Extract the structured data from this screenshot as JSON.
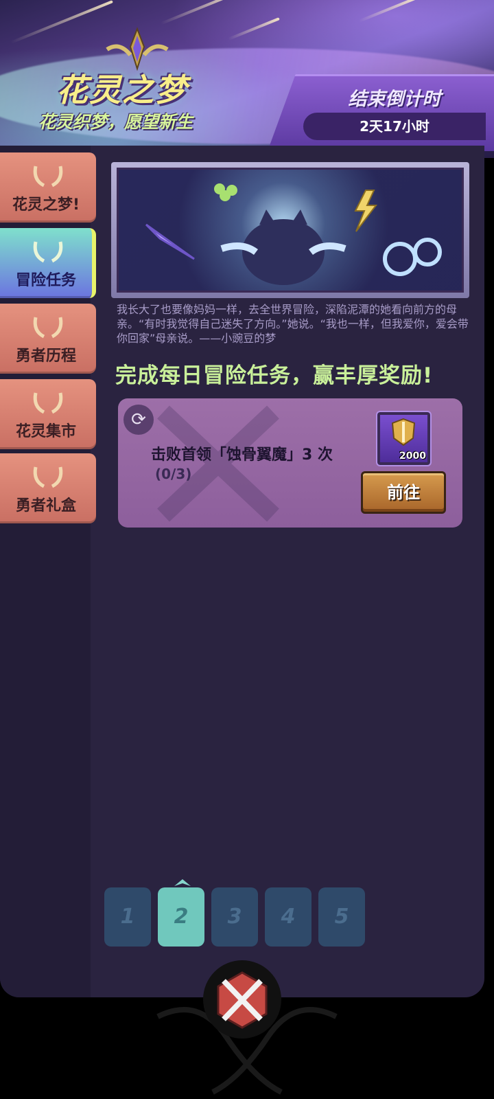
{
  "header": {
    "title": "花灵之梦",
    "subtitle": "花灵织梦，愿望新生",
    "countdown_label": "结束倒计时",
    "countdown_value": "2天17小时"
  },
  "sidebar": {
    "items": [
      {
        "label": "花灵之梦!",
        "active": false
      },
      {
        "label": "冒险任务",
        "active": true
      },
      {
        "label": "勇者历程",
        "active": false
      },
      {
        "label": "花灵集市",
        "active": false
      },
      {
        "label": "勇者礼盒",
        "active": false
      }
    ]
  },
  "main": {
    "story": "我长大了也要像妈妈一样，去全世界冒险，深陷泥潭的她看向前方的母亲。“有时我觉得自己迷失了方向。”她说。“我也一样，但我爱你，爱会带你回家”母亲说。——小豌豆的梦",
    "headline": "完成每日冒险任务，赢丰厚奖励!",
    "task": {
      "title": "击败首领「蚀骨翼魔」3 次",
      "progress": "(0/3)",
      "reward_amount": "2000",
      "go_label": "前往"
    },
    "pages": [
      "1",
      "2",
      "3",
      "4",
      "5"
    ],
    "active_page": 2
  },
  "colors": {
    "accent_green": "#c9f09a",
    "tab_active": "#7fe0cc",
    "tab_inactive": "#e5927f",
    "button": "#d69b4e"
  }
}
